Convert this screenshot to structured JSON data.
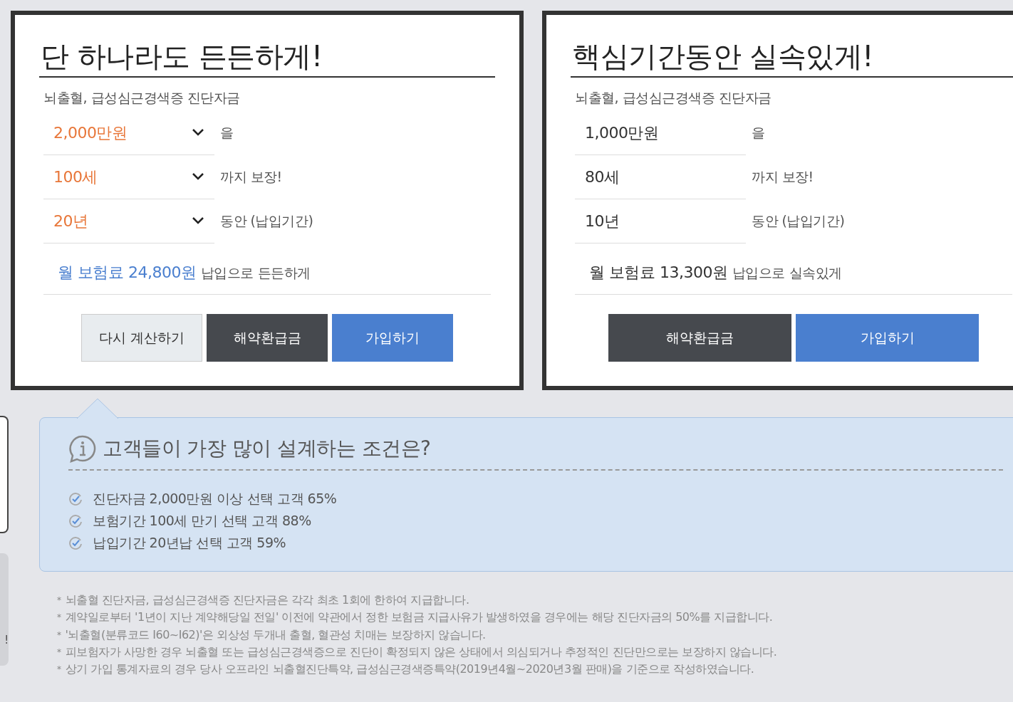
{
  "cards": [
    {
      "title": "단 하나라도 든든하게!",
      "subtitle": "뇌출혈, 급성심근경색증 진단자금",
      "fields": [
        {
          "kind": "select",
          "value": "2,000만원",
          "suffix": "을"
        },
        {
          "kind": "select",
          "value": "100세",
          "suffix": "까지 보장!"
        },
        {
          "kind": "select",
          "value": "20년",
          "suffix": "동안 (납입기간)"
        }
      ],
      "premium": {
        "kind": "highlight",
        "amount": "월 보험료 24,800원",
        "rest": "납입으로 든든하게"
      },
      "buttons": [
        {
          "label": "다시 계산하기",
          "kind": "light"
        },
        {
          "label": "해약환급금",
          "kind": "dark"
        },
        {
          "label": "가입하기",
          "kind": "primary"
        }
      ]
    },
    {
      "title": "핵심기간동안 실속있게!",
      "subtitle": "뇌출혈, 급성심근경색증 진단자금",
      "fields": [
        {
          "kind": "static",
          "value": "1,000만원",
          "suffix": "을"
        },
        {
          "kind": "static",
          "value": "80세",
          "suffix": "까지 보장!"
        },
        {
          "kind": "static",
          "value": "10년",
          "suffix": "동안 (납입기간)"
        }
      ],
      "premium": {
        "kind": "plain",
        "amount": "월 보험료 13,300원",
        "rest": "납입으로 실속있게"
      },
      "buttons": [
        {
          "label": "해약환급금",
          "kind": "dark"
        },
        {
          "label": "가입하기",
          "kind": "primary"
        }
      ]
    }
  ],
  "side_fragment": "!",
  "info": {
    "title": "고객들이 가장 많이 설계하는 조건은?",
    "items": [
      "진단자금 2,000만원 이상 선택 고객 65%",
      "보험기간 100세 만기 선택 고객 88%",
      "납입기간 20년납 선택 고객 59%"
    ]
  },
  "notes": [
    {
      "marker": "*",
      "text": "뇌출혈 진단자금, 급성심근경색증 진단자금은 각각 최초 1회에 한하여 지급합니다."
    },
    {
      "marker": "*",
      "text": "계약일로부터 '1년이 지난 계약해당일 전일' 이전에 약관에서 정한 보험금 지급사유가 발생하였을 경우에는 해당 진단자금의 50%를 지급합니다."
    },
    {
      "marker": "*",
      "text": "'뇌출혈(분류코드 I60~I62)'은 외상성 두개내 출혈, 혈관성 치매는 보장하지 않습니다."
    },
    {
      "marker": "*",
      "text": "피보험자가 사망한 경우 뇌출혈 또는 급성심근경색증으로 진단이 확정되지 않은 상태에서 의심되거나 추정적인 진단만으로는 보장하지 않습니다."
    },
    {
      "marker": "*",
      "text": "상기 가입 통계자료의 경우 당사 오프라인 뇌출혈진단특약, 급성심근경색증특약(2019년4월~2020년3월 판매)을 기준으로 작성하였습니다."
    }
  ]
}
